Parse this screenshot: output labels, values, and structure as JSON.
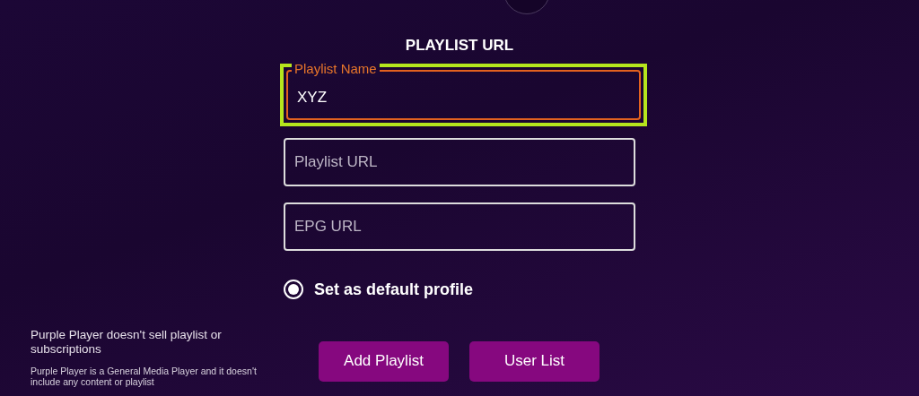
{
  "title": "PLAYLIST URL",
  "fields": [
    {
      "label": "Playlist Name",
      "value": "XYZ",
      "focused": true,
      "highlighted": true
    },
    {
      "placeholder": "Playlist URL",
      "focused": false,
      "highlighted": false
    },
    {
      "placeholder": "EPG URL",
      "focused": false,
      "highlighted": false
    }
  ],
  "default_profile": {
    "label": "Set as default profile",
    "checked": true
  },
  "notice": {
    "heading": "Purple Player doesn't sell playlist or subscriptions",
    "body": "Purple Player is a General Media Player and it doesn't include any content or playlist"
  },
  "buttons": [
    "Add Playlist",
    "User List"
  ]
}
